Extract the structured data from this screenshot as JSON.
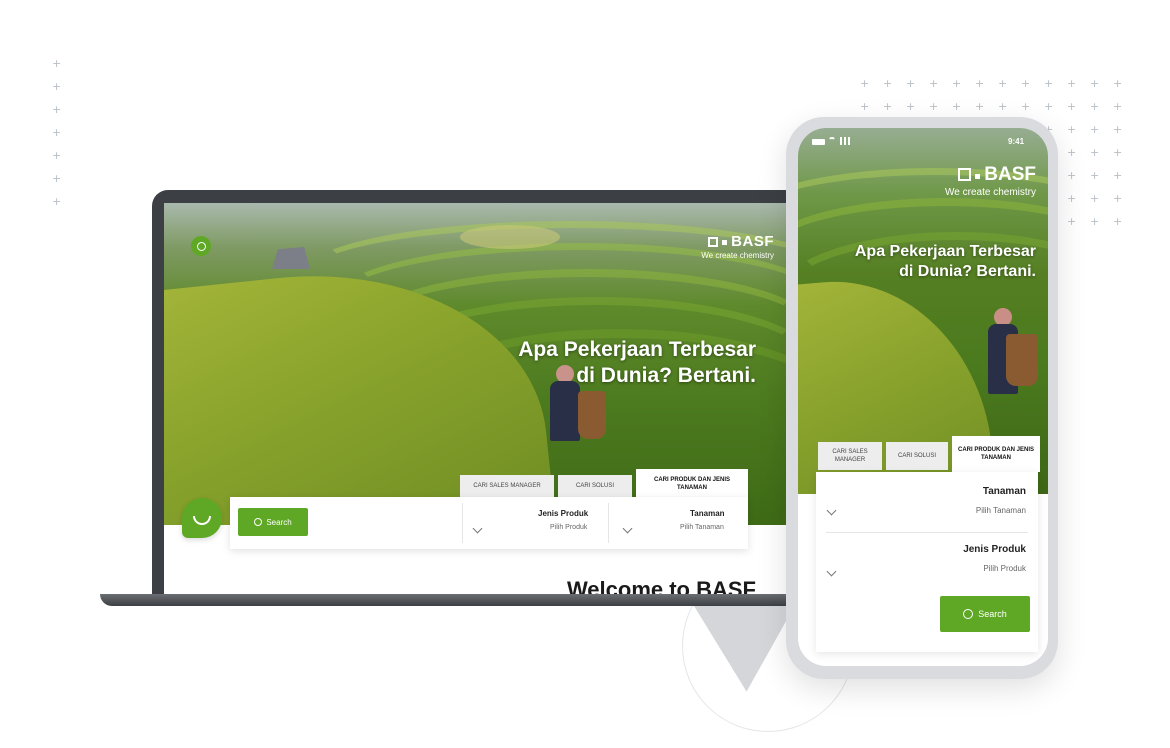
{
  "colors": {
    "brand_green": "#5fa826",
    "dark_frame": "#3c3f43",
    "background": "#ffffff"
  },
  "brand": {
    "name": "BASF",
    "tagline": "We create chemistry"
  },
  "hero": {
    "line1": "Apa Pekerjaan Terbesar",
    "line2": "di Dunia? Bertani."
  },
  "tabs": {
    "products": "CARI PRODUK DAN JENIS TANAMAN",
    "solutions": "CARI SOLUSI",
    "sales": "CARI SALES MANAGER"
  },
  "form": {
    "crop_label": "Tanaman",
    "crop_placeholder": "Pilih Tanaman",
    "product_label": "Jenis Produk",
    "product_placeholder": "Pilih Produk",
    "search_label": "Search"
  },
  "welcome": "Welcome to BASF",
  "phone_status": {
    "time": "9:41"
  },
  "icons": [
    "chat-icon",
    "search-icon",
    "chevron-down-icon",
    "signal-icon",
    "wifi-icon",
    "battery-icon"
  ]
}
